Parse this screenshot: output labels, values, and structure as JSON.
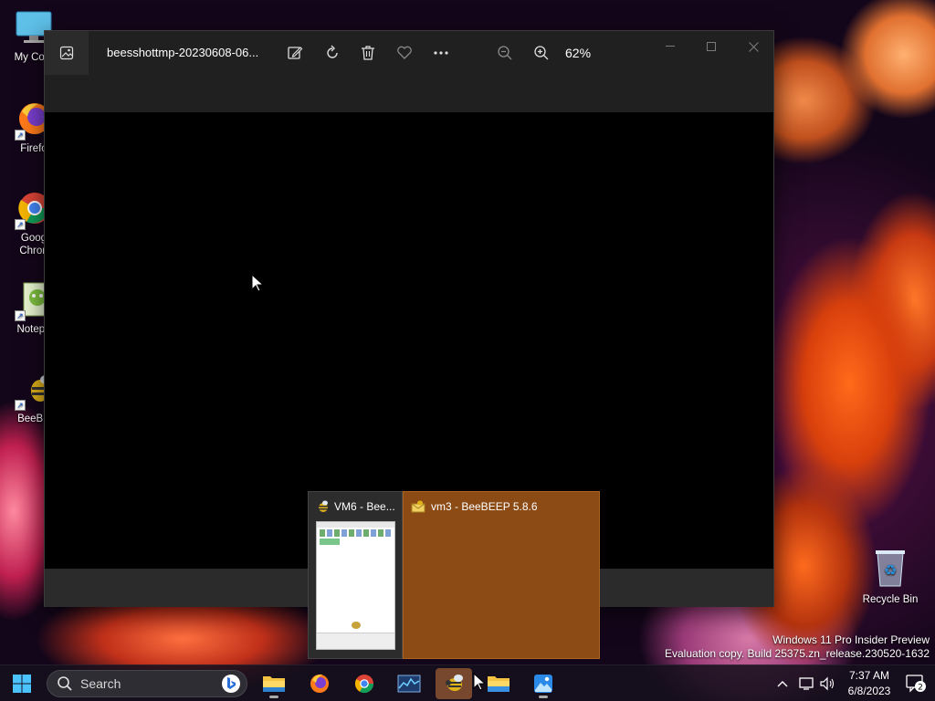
{
  "desktop": {
    "icons": [
      {
        "label": "My Com",
        "icon": "monitor-icon"
      },
      {
        "label": "Firefo",
        "icon": "firefox-icon"
      },
      {
        "label": "Goog",
        "label2": "Chron",
        "icon": "chrome-icon"
      },
      {
        "label": "Notepa",
        "icon": "notepad-icon"
      },
      {
        "label": "BeeBE",
        "icon": "beebeep-icon"
      }
    ],
    "recycle_bin": "Recycle Bin",
    "watermark": {
      "line1": "Windows 11 Pro Insider Preview",
      "line2": "Evaluation copy. Build 25375.zn_release.230520-1632"
    }
  },
  "photos_window": {
    "title": "beesshottmp-20230608-06...",
    "zoom": "62%",
    "toolbar": [
      "edit-image-icon",
      "rotate-icon",
      "delete-icon",
      "favorite-icon",
      "more-icon",
      "zoom-out-icon",
      "zoom-in-icon"
    ],
    "controls": [
      "minimize-icon",
      "maximize-icon",
      "close-icon"
    ]
  },
  "thumbnails": [
    {
      "title": "VM6 - Bee...",
      "icon": "beebeep-icon"
    },
    {
      "title": "vm3 - BeeBEEP 5.8.6",
      "icon": "beebeep-mail-icon"
    }
  ],
  "taskbar": {
    "search_placeholder": "Search",
    "apps": [
      "start-icon",
      "file-explorer-icon",
      "firefox-icon",
      "chrome-icon",
      "resource-monitor-icon",
      "beebeep-icon",
      "folder-icon",
      "photos-icon"
    ],
    "active_app": "beebeep-icon",
    "clock_time": "7:37 AM",
    "clock_date": "6/8/2023",
    "notification_count": "2"
  }
}
